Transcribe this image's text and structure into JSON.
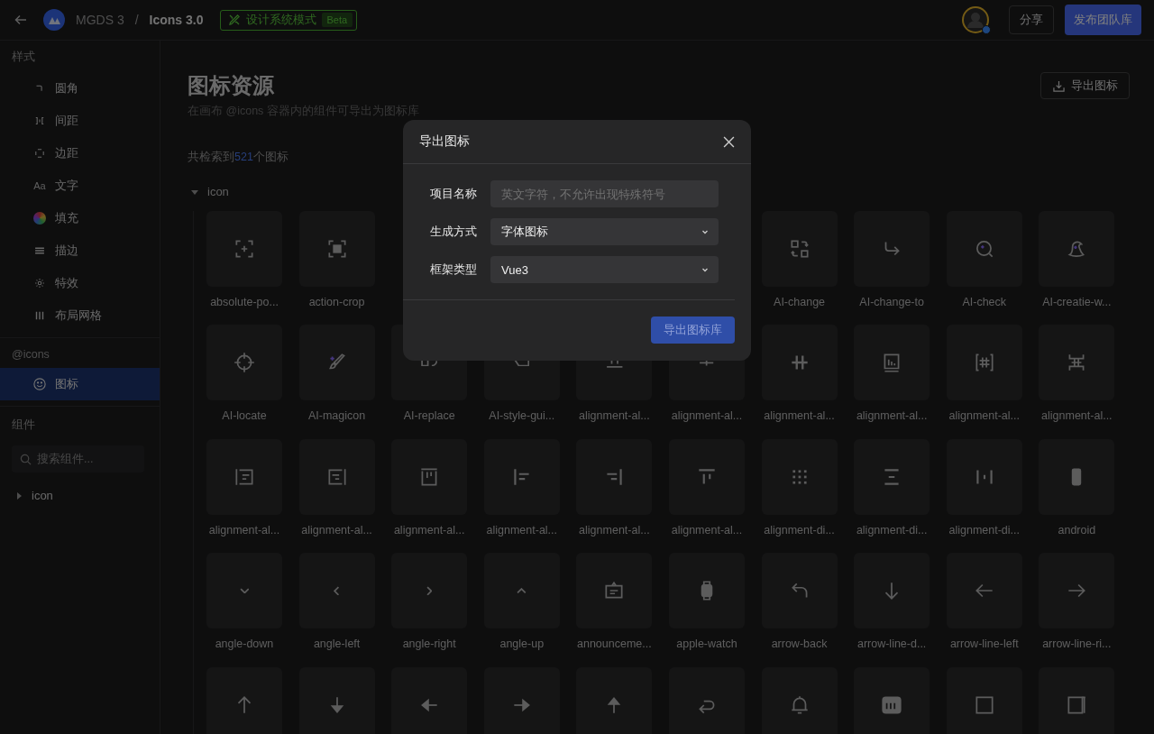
{
  "topbar": {
    "project": "MGDS 3",
    "separator": "/",
    "file": "Icons 3.0",
    "mode_badge": {
      "label": "设计系统模式",
      "tag": "Beta"
    },
    "share_button": "分享",
    "publish_button": "发布团队库"
  },
  "sidebar": {
    "sections": [
      {
        "title": "样式",
        "items": [
          {
            "label": "圆角",
            "selected": false
          },
          {
            "label": "间距",
            "selected": false
          },
          {
            "label": "边距",
            "selected": false
          },
          {
            "label": "文字",
            "glyph": "Aa",
            "selected": false
          },
          {
            "label": "填充",
            "selected": false
          },
          {
            "label": "描边",
            "selected": false
          },
          {
            "label": "特效",
            "selected": false
          },
          {
            "label": "布局网格",
            "selected": false
          }
        ]
      },
      {
        "title": "@icons",
        "items": [
          {
            "label": "图标",
            "selected": true
          }
        ]
      }
    ],
    "components": {
      "title": "组件",
      "search": {
        "placeholder": "搜索组件..."
      },
      "tree": [
        {
          "label": "icon",
          "expanded": false
        }
      ]
    }
  },
  "main": {
    "title": "图标资源",
    "subtitle": "在画布 @icons 容器内的组件可导出为图标库",
    "export_button": "导出图标",
    "count_prefix": "共检索到",
    "count": "521",
    "count_suffix": "个图标",
    "group": {
      "label": "icon",
      "expanded": true
    },
    "icons": [
      {
        "kind": "icon",
        "label": "absolute-po..."
      },
      {
        "kind": "icon",
        "label": "action-crop"
      },
      {
        "kind": "covered"
      },
      {
        "kind": "covered"
      },
      {
        "kind": "covered"
      },
      {
        "kind": "covered"
      },
      {
        "kind": "icon",
        "label": "AI-change"
      },
      {
        "kind": "icon",
        "label": "AI-change-to"
      },
      {
        "kind": "icon",
        "label": "AI-check"
      },
      {
        "kind": "icon",
        "label": "AI-creatie-w..."
      },
      {
        "kind": "icon",
        "label": "AI-locate"
      },
      {
        "kind": "icon",
        "label": "AI-magicon"
      },
      {
        "kind": "icon",
        "label": "AI-replace"
      },
      {
        "kind": "icon",
        "label": "AI-style-gui..."
      },
      {
        "kind": "icon",
        "label": "alignment-al..."
      },
      {
        "kind": "icon",
        "label": "alignment-al..."
      },
      {
        "kind": "icon",
        "label": "alignment-al..."
      },
      {
        "kind": "icon",
        "label": "alignment-al..."
      },
      {
        "kind": "icon",
        "label": "alignment-al..."
      },
      {
        "kind": "icon",
        "label": "alignment-al..."
      },
      {
        "kind": "icon",
        "label": "alignment-al..."
      },
      {
        "kind": "icon",
        "label": "alignment-al..."
      },
      {
        "kind": "icon",
        "label": "alignment-al..."
      },
      {
        "kind": "icon",
        "label": "alignment-al..."
      },
      {
        "kind": "icon",
        "label": "alignment-al..."
      },
      {
        "kind": "icon",
        "label": "alignment-al..."
      },
      {
        "kind": "icon",
        "label": "alignment-di..."
      },
      {
        "kind": "icon",
        "label": "alignment-di..."
      },
      {
        "kind": "icon",
        "label": "alignment-di..."
      },
      {
        "kind": "icon",
        "label": "android"
      },
      {
        "kind": "icon",
        "label": "angle-down"
      },
      {
        "kind": "icon",
        "label": "angle-left"
      },
      {
        "kind": "icon",
        "label": "angle-right"
      },
      {
        "kind": "icon",
        "label": "angle-up"
      },
      {
        "kind": "icon",
        "label": "announceme..."
      },
      {
        "kind": "icon",
        "label": "apple-watch"
      },
      {
        "kind": "icon",
        "label": "arrow-back"
      },
      {
        "kind": "icon",
        "label": "arrow-line-d..."
      },
      {
        "kind": "icon",
        "label": "arrow-line-left"
      },
      {
        "kind": "icon",
        "label": "arrow-line-ri..."
      },
      {
        "kind": "icon"
      },
      {
        "kind": "icon"
      },
      {
        "kind": "icon"
      },
      {
        "kind": "icon"
      },
      {
        "kind": "icon"
      },
      {
        "kind": "icon"
      },
      {
        "kind": "icon"
      },
      {
        "kind": "icon"
      },
      {
        "kind": "icon"
      },
      {
        "kind": "icon"
      }
    ]
  },
  "modal": {
    "title": "导出图标",
    "fields": [
      {
        "kind": "input",
        "label": "项目名称",
        "placeholder": "英文字符，不允许出现特殊符号"
      },
      {
        "kind": "select",
        "label": "生成方式",
        "value": "字体图标"
      },
      {
        "kind": "select",
        "label": "框架类型",
        "value": "Vue3"
      }
    ],
    "submit_button": "导出图标库"
  }
}
